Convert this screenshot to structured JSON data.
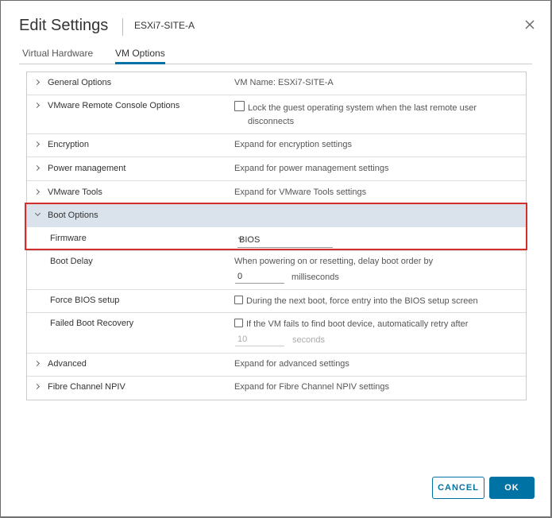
{
  "dialog": {
    "title": "Edit Settings",
    "subtitle": "ESXi7-SITE-A"
  },
  "tabs": [
    {
      "label": "Virtual Hardware",
      "active": false
    },
    {
      "label": "VM Options",
      "active": true
    }
  ],
  "rows": {
    "general": {
      "label": "General Options",
      "value": "VM Name: ESXi7-SITE-A"
    },
    "vmrc": {
      "label": "VMware Remote Console Options",
      "value_line1": "Lock the guest operating system when the last remote user",
      "value_line2": "disconnects",
      "checked": false
    },
    "encryption": {
      "label": "Encryption",
      "value": "Expand for encryption settings"
    },
    "power": {
      "label": "Power management",
      "value": "Expand for power management settings"
    },
    "tools": {
      "label": "VMware Tools",
      "value": "Expand for VMware Tools settings"
    },
    "boot": {
      "label": "Boot Options",
      "expanded": true
    },
    "firmware": {
      "label": "Firmware",
      "value": "BIOS"
    },
    "boot_delay": {
      "label": "Boot Delay",
      "desc": "When powering on or resetting, delay boot order by",
      "input_value": "0",
      "unit": "milliseconds"
    },
    "force_bios": {
      "label": "Force BIOS setup",
      "value": "During the next boot, force entry into the BIOS setup screen",
      "checked": false
    },
    "failed_recovery": {
      "label": "Failed Boot Recovery",
      "value": "If the VM fails to find boot device, automatically retry after",
      "input_value": "10",
      "unit": "seconds",
      "checked": false
    },
    "advanced": {
      "label": "Advanced",
      "value": "Expand for advanced settings"
    },
    "npiv": {
      "label": "Fibre Channel NPIV",
      "value": "Expand for Fibre Channel NPIV settings"
    }
  },
  "buttons": {
    "cancel": "CANCEL",
    "ok": "OK"
  },
  "colors": {
    "accent": "#0072a3",
    "highlight_border": "#d32f2f",
    "boot_header_bg": "#dae3ec"
  }
}
